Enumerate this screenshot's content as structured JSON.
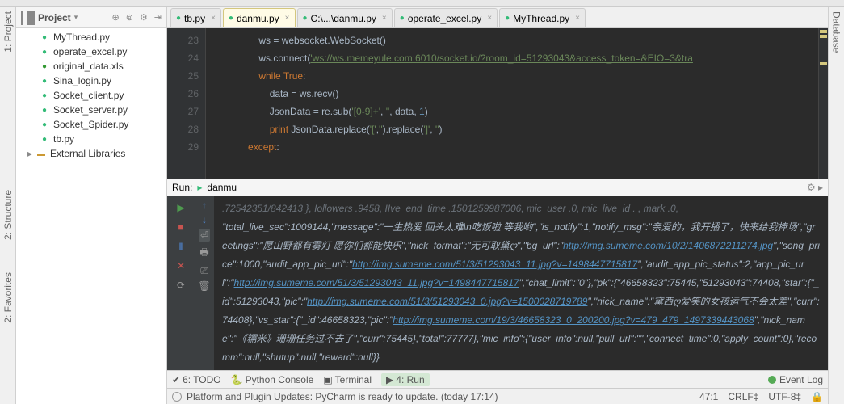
{
  "ide": {
    "project_label": "Project"
  },
  "sidebars": {
    "left1": "1: Project",
    "left2": "2: Structure",
    "left3": "2: Favorites",
    "right1": "Database"
  },
  "project_tree": [
    {
      "name": "MyThread.py",
      "icon": "py"
    },
    {
      "name": "operate_excel.py",
      "icon": "py"
    },
    {
      "name": "original_data.xls",
      "icon": "xls"
    },
    {
      "name": "Sina_login.py",
      "icon": "py"
    },
    {
      "name": "Socket_client.py",
      "icon": "py"
    },
    {
      "name": "Socket_server.py",
      "icon": "py"
    },
    {
      "name": "Socket_Spider.py",
      "icon": "py"
    },
    {
      "name": "tb.py",
      "icon": "py"
    }
  ],
  "ext_lib": "External Libraries",
  "tabs": [
    {
      "label": "tb.py",
      "active": false
    },
    {
      "label": "danmu.py",
      "active": true
    },
    {
      "label": "C:\\...\\danmu.py",
      "active": false
    },
    {
      "label": "operate_excel.py",
      "active": false
    },
    {
      "label": "MyThread.py",
      "active": false
    }
  ],
  "gutter": [
    "23",
    "24",
    "25",
    "26",
    "27",
    "28",
    "29"
  ],
  "code_lines": [
    {
      "indent": 16,
      "parts": [
        {
          "t": "ws ",
          "c": ""
        },
        {
          "t": "= ",
          "c": ""
        },
        {
          "t": "websocket.WebSocket()",
          "c": ""
        }
      ]
    },
    {
      "indent": 16,
      "parts": [
        {
          "t": "ws.connect(",
          "c": ""
        },
        {
          "t": "'ws://ws.memeyule.com:6010/socket.io/?room_id=51293043&access_token=&EIO=3&tra",
          "c": "s u"
        }
      ]
    },
    {
      "indent": 16,
      "parts": [
        {
          "t": "while ",
          "c": "k"
        },
        {
          "t": "True",
          "c": "k"
        },
        {
          "t": ":",
          "c": ""
        }
      ]
    },
    {
      "indent": 20,
      "parts": [
        {
          "t": "data ",
          "c": ""
        },
        {
          "t": "= ",
          "c": ""
        },
        {
          "t": "ws.recv()",
          "c": ""
        }
      ]
    },
    {
      "indent": 20,
      "parts": [
        {
          "t": "JsonData ",
          "c": ""
        },
        {
          "t": "= ",
          "c": ""
        },
        {
          "t": "re.sub(",
          "c": ""
        },
        {
          "t": "'[0-9]+'",
          "c": "s"
        },
        {
          "t": ", ",
          "c": ""
        },
        {
          "t": "''",
          "c": "s"
        },
        {
          "t": ", data, ",
          "c": ""
        },
        {
          "t": "1",
          "c": "n"
        },
        {
          "t": ")",
          "c": ""
        }
      ]
    },
    {
      "indent": 20,
      "parts": [
        {
          "t": "print ",
          "c": "k"
        },
        {
          "t": "JsonData.replace(",
          "c": ""
        },
        {
          "t": "'['",
          "c": "s"
        },
        {
          "t": ",",
          "c": ""
        },
        {
          "t": "''",
          "c": "s"
        },
        {
          "t": ").replace(",
          "c": ""
        },
        {
          "t": "']'",
          "c": "s"
        },
        {
          "t": ", ",
          "c": ""
        },
        {
          "t": "''",
          "c": "s"
        },
        {
          "t": ")",
          "c": ""
        }
      ]
    },
    {
      "indent": 12,
      "parts": [
        {
          "t": "except",
          "c": "k"
        },
        {
          "t": ":",
          "c": ""
        }
      ]
    }
  ],
  "run": {
    "label": "Run:",
    "config": "danmu",
    "truncated_top": ".72542351/842413 }, Iollowers .9458, IIve_end_time .1501259987006, mic_user .0, mic_live_id . , mark .0,"
  },
  "console_parts": [
    {
      "t": "\"total_live_sec\":1009144,\"message\":\"一生热爱 回头太难\\n吃饭啦 等我哟\",\"is_notify\":1,\"notify_msg\":\"亲爱的，我开播了，快来给我捧场\",\"greetings\":\"愿山野都有雾灯 愿你们都能快乐\",\"nick_format\":\"无可取黛ღ\",\"bg_url\":\""
    },
    {
      "t": "http://img.sumeme.com/10/2/1406872211274.jpg",
      "url": true
    },
    {
      "t": "\",\"song_price\":1000,\"audit_app_pic_url\":\""
    },
    {
      "t": "http://img.sumeme.com/51/3/51293043_11.jpg?v=1498447715817",
      "url": true
    },
    {
      "t": "\",\"audit_app_pic_status\":2,\"app_pic_url\":\""
    },
    {
      "t": "http://img.sumeme.com/51/3/51293043_11.jpg?v=1498447715817",
      "url": true
    },
    {
      "t": "\",\"chat_limit\":\"0\"},\"pk\":{\"46658323\":75445,\"51293043\":74408,\"star\":{\"_id\":51293043,\"pic\":\""
    },
    {
      "t": "http://img.sumeme.com/51/3/51293043_0.jpg?v=1500028719789",
      "url": true
    },
    {
      "t": "\",\"nick_name\":\"黛西ღ爱笑的女孩运气不会太差\",\"curr\":74408},\"vs_star\":{\"_id\":46658323,\"pic\":\""
    },
    {
      "t": "http://img.sumeme.com/19/3/46658323_0_200200.jpg?v=479_479_1497339443068",
      "url": true
    },
    {
      "t": "\",\"nick_name\":\"《糯米》珊珊任务过不去了\",\"curr\":75445},\"total\":77777},\"mic_info\":{\"user_info\":null,\"pull_url\":\"\",\"connect_time\":0,\"apply_count\":0},\"recomm\":null,\"shutup\":null,\"reward\":null}}"
    }
  ],
  "bottom_tabs": {
    "todo": "6: TODO",
    "pyconsole": "Python Console",
    "terminal": "Terminal",
    "run": "4: Run",
    "eventlog": "Event Log"
  },
  "status": {
    "msg": "Platform and Plugin Updates: PyCharm is ready to update. (today 17:14)",
    "pos": "47:1",
    "sep": "CRLF‡",
    "enc": "UTF-8‡"
  }
}
